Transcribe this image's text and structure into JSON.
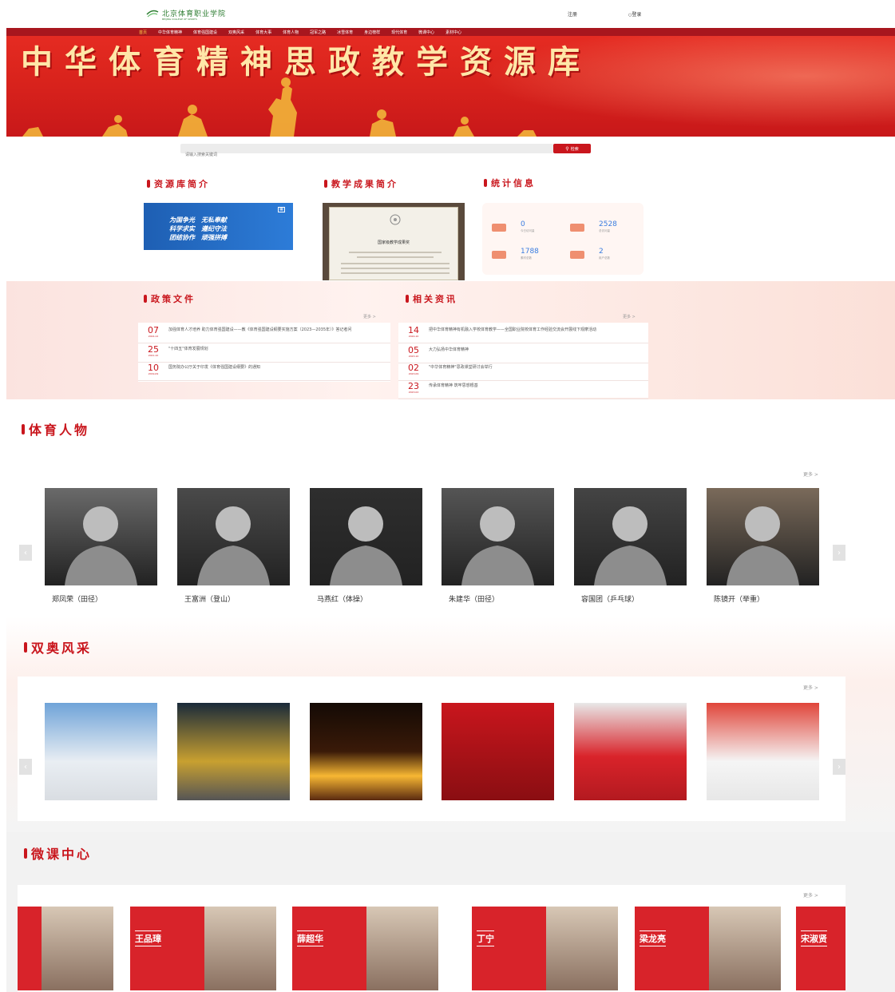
{
  "header": {
    "logo_text": "北京体育职业学院",
    "logo_sub": "BEIJING COLLEGE OF SPORTS",
    "register": "注册",
    "login": "登录"
  },
  "nav": {
    "items": [
      "首页",
      "中华体育精神",
      "体育强国建设",
      "双奥风采",
      "体育大事",
      "体育人物",
      "冠军之路",
      "冰雪体育",
      "身边榜样",
      "现代体育",
      "微课中心",
      "素材中心"
    ],
    "active_index": 0
  },
  "banner": {
    "title": "中华体育精神思政教学资源库"
  },
  "search": {
    "placeholder": "请输入搜索关键词",
    "button": "检索"
  },
  "sections": {
    "intro": "资源库简介",
    "achievement": "教学成果简介",
    "stats": "统计信息",
    "policy": "政策文件",
    "news": "相关资讯",
    "figures": "体育人物",
    "olympics": "双奥风采",
    "micro": "微课中心"
  },
  "intro_image": {
    "line1": "为国争光　无私奉献",
    "line2": "科学求实　遵纪守法",
    "line3": "团结协作　顽强拼搏"
  },
  "certificate": {
    "title": "国家级教学成果奖"
  },
  "stats": [
    {
      "value": "0",
      "label": "今日访问量"
    },
    {
      "value": "2528",
      "label": "总访问量"
    },
    {
      "value": "1788",
      "label": "素材总数"
    },
    {
      "value": "2",
      "label": "用户总数"
    }
  ],
  "more_label": "更多 >",
  "policy_list": [
    {
      "day": "07",
      "ym": "2024-12",
      "title": "加强体育人才培养 助力体育强国建设——教《体育强国建设纲要实施方案（2023—2035年）》答记者问"
    },
    {
      "day": "25",
      "ym": "2021-10",
      "title": "\"十四五\"体育发展规划"
    },
    {
      "day": "10",
      "ym": "2019-09",
      "title": "国务院办公厅关于印发《体育强国建设纲要》的通知"
    }
  ],
  "news_list": [
    {
      "day": "14",
      "ym": "2024-10",
      "title": "把中华体育精神有机融入学校体育教学——全国职业院校体育工作经验交流会开展线下观摩活动"
    },
    {
      "day": "05",
      "ym": "2023-10",
      "title": "大力弘扬中华体育精神"
    },
    {
      "day": "02",
      "ym": "2023-09",
      "title": "\"中华体育精神\"思政课堂研讨会举行"
    },
    {
      "day": "23",
      "ym": "2023-02",
      "title": "传承体育精神 筑牢思想根基"
    }
  ],
  "figures": [
    {
      "name": "郑凤荣（田径）"
    },
    {
      "name": "王富洲（登山）"
    },
    {
      "name": "马燕红（体操）"
    },
    {
      "name": "朱建华（田径）"
    },
    {
      "name": "容国团（乒乓球）"
    },
    {
      "name": "陈镜开（举重）"
    }
  ],
  "olympics_photos": [
    {
      "icon": "speed-skating-photo"
    },
    {
      "icon": "athletes-parade-photo"
    },
    {
      "icon": "torch-cauldron-photo"
    },
    {
      "icon": "beijing-2008-emblem-photo"
    },
    {
      "icon": "delegation-celebration-photo"
    },
    {
      "icon": "freestyle-skier-photo"
    }
  ],
  "micro_courses": [
    {
      "name": ""
    },
    {
      "name": "王品璋"
    },
    {
      "name": "薛超华"
    },
    {
      "name": "丁宁"
    },
    {
      "name": "梁龙亮"
    },
    {
      "name": "宋淑贤"
    }
  ],
  "colors": {
    "primary": "#c9161d",
    "nav": "#a8161e",
    "stat_number": "#3b7de0"
  }
}
